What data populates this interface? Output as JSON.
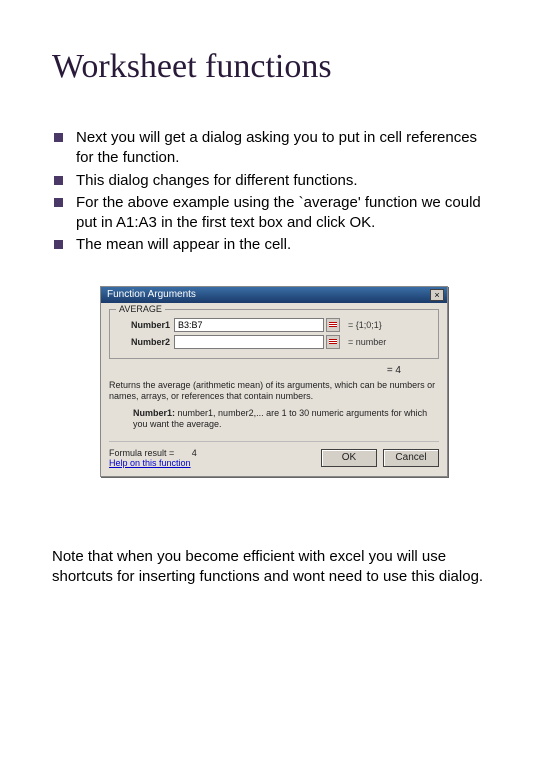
{
  "title": "Worksheet functions",
  "bullets": [
    "Next you will get a dialog asking you to put in cell references for the function.",
    "This dialog changes for different functions.",
    "For the above example using the `average' function we could put in A1:A3 in the first text box and click OK.",
    "The mean will appear in the cell."
  ],
  "note": "Note that when you become efficient with excel you will use shortcuts for inserting functions and wont need to use this dialog.",
  "dialog": {
    "title": "Function Arguments",
    "close": "×",
    "fn_name": "AVERAGE",
    "arg1_label": "Number1",
    "arg1_value": "B3:B7",
    "arg1_hint": "= {1;0;1}",
    "arg2_label": "Number2",
    "arg2_value": "",
    "arg2_hint": "= number",
    "equals": "= 4",
    "desc": "Returns the average (arithmetic mean) of its arguments, which can be numbers or names, arrays, or references that contain numbers.",
    "desc2_label": "Number1:",
    "desc2_text": "number1, number2,... are 1 to 30 numeric arguments for which you want the average.",
    "result_label": "Formula result =",
    "result_value": "4",
    "help": "Help on this function",
    "ok": "OK",
    "cancel": "Cancel"
  }
}
